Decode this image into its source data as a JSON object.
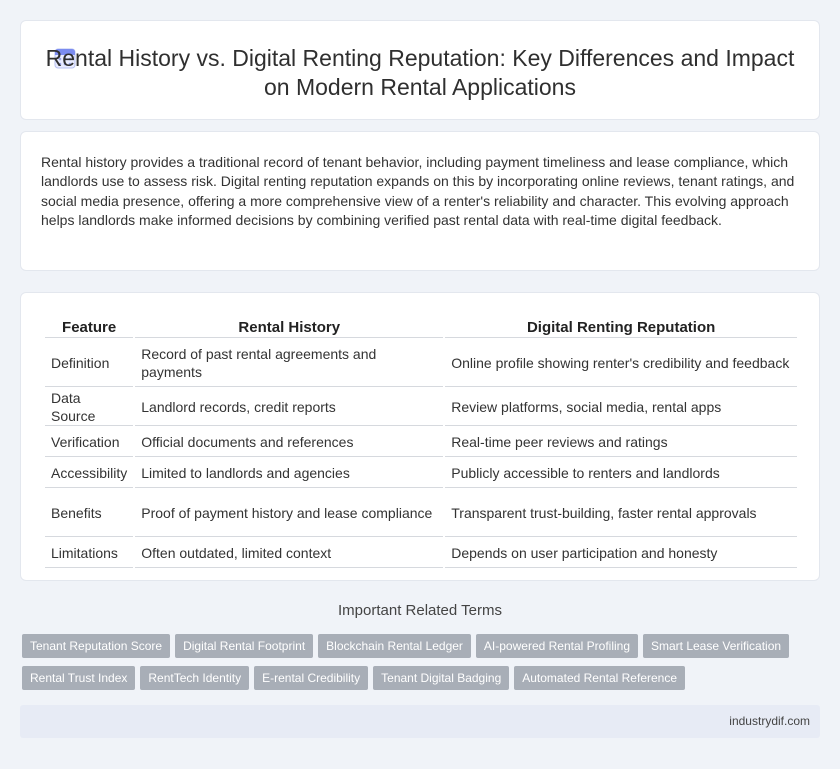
{
  "header": {
    "title": "Rental History vs. Digital Renting Reputation: Key Differences and Impact on Modern Rental Applications",
    "icon": "calendar-icon"
  },
  "intro": {
    "text": "Rental history provides a traditional record of tenant behavior, including payment timeliness and lease compliance, which landlords use to assess risk. Digital renting reputation expands on this by incorporating online reviews, tenant ratings, and social media presence, offering a more comprehensive view of a renter's reliability and character. This evolving approach helps landlords make informed decisions by combining verified past rental data with real-time digital feedback."
  },
  "table": {
    "headers": [
      "Feature",
      "Rental History",
      "Digital Renting Reputation"
    ],
    "rows": [
      [
        "Definition",
        "Record of past rental agreements and payments",
        "Online profile showing renter's credibility and feedback"
      ],
      [
        "Data Source",
        "Landlord records, credit reports",
        "Review platforms, social media, rental apps"
      ],
      [
        "Verification",
        "Official documents and references",
        "Real-time peer reviews and ratings"
      ],
      [
        "Accessibility",
        "Limited to landlords and agencies",
        "Publicly accessible to renters and landlords"
      ],
      [
        "Benefits",
        "Proof of payment history and lease compliance",
        "Transparent trust-building, faster rental approvals"
      ],
      [
        "Limitations",
        "Often outdated, limited context",
        "Depends on user participation and honesty"
      ]
    ]
  },
  "related": {
    "title": "Important Related Terms",
    "tags_row1": [
      "Tenant Reputation Score",
      "Digital Rental Footprint",
      "Blockchain Rental Ledger",
      "AI-powered Rental Profiling",
      "Smart Lease Verification"
    ],
    "tags_row2": [
      "Rental Trust Index",
      "RentTech Identity",
      "E-rental Credibility",
      "Tenant Digital Badging",
      "Automated Rental Reference"
    ]
  },
  "footer": {
    "site": "industrydif.com"
  },
  "colors": {
    "background": "#f0f3f8",
    "tag": "#a8aeb7",
    "footer": "#e7ebf5"
  }
}
